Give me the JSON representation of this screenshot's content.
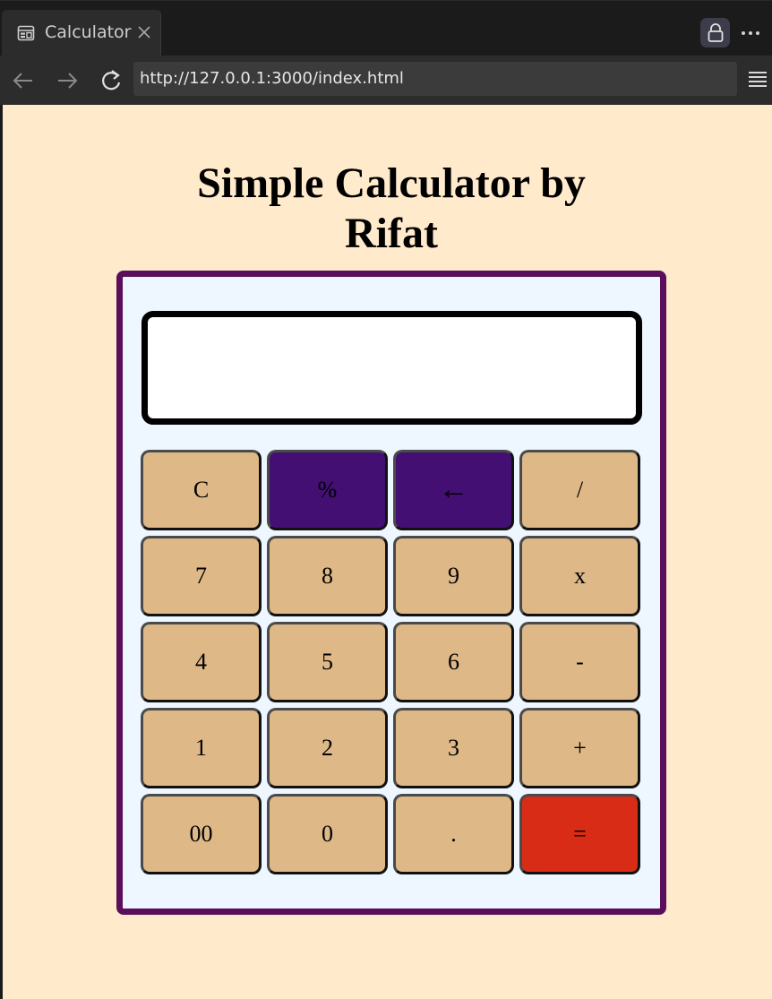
{
  "browser": {
    "tab": {
      "title": "Calculator",
      "icon": "browser-tab-page-icon",
      "close_icon": "close-icon"
    },
    "address_bar": {
      "url": "http://127.0.0.1:3000/index.html"
    },
    "nav": {
      "back_icon": "arrow-left-icon",
      "forward_icon": "arrow-right-icon",
      "reload_icon": "reload-icon"
    },
    "toolbar": {
      "lock_icon": "lock-icon",
      "more_icon": "more-dots-icon",
      "menu_icon": "hamburger-menu-icon"
    }
  },
  "page": {
    "title_line1": "Simple Calculator by",
    "title_line2": "Rifat",
    "background_color": "#ffeacc"
  },
  "calculator": {
    "display_value": "",
    "border_color": "#5b0e5a",
    "keys": [
      {
        "label": "C",
        "role": "clear"
      },
      {
        "label": "%",
        "role": "operator"
      },
      {
        "label": "←",
        "role": "backspace"
      },
      {
        "label": "/",
        "role": "operator"
      },
      {
        "label": "7",
        "role": "digit"
      },
      {
        "label": "8",
        "role": "digit"
      },
      {
        "label": "9",
        "role": "digit"
      },
      {
        "label": "x",
        "role": "operator"
      },
      {
        "label": "4",
        "role": "digit"
      },
      {
        "label": "5",
        "role": "digit"
      },
      {
        "label": "6",
        "role": "digit"
      },
      {
        "label": "-",
        "role": "operator"
      },
      {
        "label": "1",
        "role": "digit"
      },
      {
        "label": "2",
        "role": "digit"
      },
      {
        "label": "3",
        "role": "digit"
      },
      {
        "label": "+",
        "role": "operator"
      },
      {
        "label": "00",
        "role": "digit"
      },
      {
        "label": "0",
        "role": "digit"
      },
      {
        "label": ".",
        "role": "decimal"
      },
      {
        "label": "=",
        "role": "equals"
      }
    ],
    "colors": {
      "key": "#deb887",
      "accent_key": "#430f73",
      "equals_key": "#d92c16"
    }
  }
}
